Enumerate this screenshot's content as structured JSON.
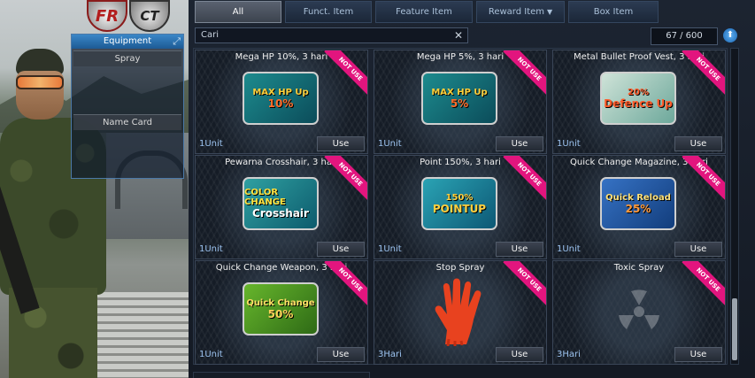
{
  "logos": {
    "fr": "FR",
    "ct": "CT"
  },
  "equipment": {
    "title": "Equipment",
    "slots": [
      {
        "label": "Spray"
      },
      {
        "label": "Name Card"
      }
    ]
  },
  "tabs": [
    {
      "label": "All",
      "active": true
    },
    {
      "label": "Funct. Item",
      "active": false
    },
    {
      "label": "Feature Item",
      "active": false
    },
    {
      "label": "Reward Item",
      "active": false,
      "dropdown": true
    },
    {
      "label": "Box Item",
      "active": false
    }
  ],
  "search": {
    "value": "Cari"
  },
  "inventory_count": "67 / 600",
  "items": [
    {
      "title": "Mega HP 10%, 3 hari",
      "badge": "NOT USE",
      "unit": "1Unit",
      "use": "Use",
      "thumb": {
        "line1": "MAX HP Up",
        "line2": "10%"
      }
    },
    {
      "title": "Mega HP 5%, 3 hari",
      "badge": "NOT USE",
      "unit": "1Unit",
      "use": "Use",
      "thumb": {
        "line1": "MAX HP Up",
        "line2": "5%"
      }
    },
    {
      "title": "Metal Bullet Proof Vest, 3 hari",
      "badge": "NOT USE",
      "unit": "1Unit",
      "use": "Use",
      "thumb": {
        "line1": "20%",
        "line2": "Defence Up"
      }
    },
    {
      "title": "Pewarna Crosshair, 3 hari",
      "badge": "NOT USE",
      "unit": "1Unit",
      "use": "Use",
      "thumb": {
        "line1": "COLOR CHANGE",
        "line2": "Crosshair"
      }
    },
    {
      "title": "Point 150%, 3 hari",
      "badge": "NOT USE",
      "unit": "1Unit",
      "use": "Use",
      "thumb": {
        "line1": "150%",
        "line2": "POINTUP"
      }
    },
    {
      "title": "Quick Change Magazine, 3 hari",
      "badge": "NOT USE",
      "unit": "1Unit",
      "use": "Use",
      "thumb": {
        "line1": "Quick Reload",
        "line2": "25%"
      }
    },
    {
      "title": "Quick Change Weapon, 3 hari",
      "badge": "NOT USE",
      "unit": "1Unit",
      "use": "Use",
      "thumb": {
        "line1": "Quick Change",
        "line2": "50%"
      }
    },
    {
      "title": "Stop Spray",
      "badge": "NOT USE",
      "unit": "3Hari",
      "use": "Use"
    },
    {
      "title": "Toxic Spray",
      "badge": "NOT USE",
      "unit": "3Hari",
      "use": "Use"
    }
  ],
  "colors": {
    "badge": "#e2157e",
    "unit_text": "#9cc3f0",
    "accent": "#3a87c8"
  }
}
